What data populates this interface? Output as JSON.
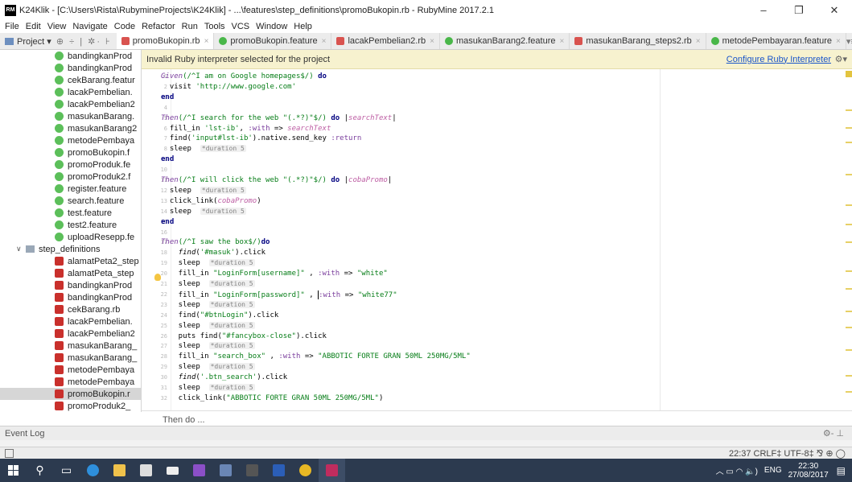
{
  "window": {
    "title": "K24Klik - [C:\\Users\\Rista\\RubymineProjects\\K24Klik] - ...\\features\\step_definitions\\promoBukopin.rb - RubyMine 2017.2.1",
    "app_badge": "RM",
    "minimize": "–",
    "maximize": "❐",
    "close": "✕"
  },
  "menu": [
    "File",
    "Edit",
    "View",
    "Navigate",
    "Code",
    "Refactor",
    "Run",
    "Tools",
    "VCS",
    "Window",
    "Help"
  ],
  "toolwindow": {
    "label": "Project ▾",
    "tools": "⊕ ÷ | ✲· ⊦"
  },
  "tabs": [
    {
      "label": "promoBukopin.rb",
      "type": "rb",
      "active": true
    },
    {
      "label": "promoBukopin.feature",
      "type": "feat"
    },
    {
      "label": "lacakPembelian2.rb",
      "type": "rb"
    },
    {
      "label": "masukanBarang2.feature",
      "type": "feat"
    },
    {
      "label": "masukanBarang_steps2.rb",
      "type": "rb"
    },
    {
      "label": "metodePembayaran.feature",
      "type": "feat"
    }
  ],
  "tab_overflow": "▾≡",
  "tree": [
    {
      "label": "bandingkanProd",
      "type": "feat",
      "indent": 1
    },
    {
      "label": "bandingkanProd",
      "type": "feat",
      "indent": 1
    },
    {
      "label": "cekBarang.featur",
      "type": "feat",
      "indent": 1
    },
    {
      "label": "lacakPembelian.",
      "type": "feat",
      "indent": 1
    },
    {
      "label": "lacakPembelian2",
      "type": "feat",
      "indent": 1
    },
    {
      "label": "masukanBarang.",
      "type": "feat",
      "indent": 1
    },
    {
      "label": "masukanBarang2",
      "type": "feat",
      "indent": 1
    },
    {
      "label": "metodePembaya",
      "type": "feat",
      "indent": 1
    },
    {
      "label": "promoBukopin.f",
      "type": "feat",
      "indent": 1
    },
    {
      "label": "promoProduk.fe",
      "type": "feat",
      "indent": 1
    },
    {
      "label": "promoProduk2.f",
      "type": "feat",
      "indent": 1
    },
    {
      "label": "register.feature",
      "type": "feat",
      "indent": 1
    },
    {
      "label": "search.feature",
      "type": "feat",
      "indent": 1
    },
    {
      "label": "test.feature",
      "type": "feat",
      "indent": 1
    },
    {
      "label": "test2.feature",
      "type": "feat",
      "indent": 1
    },
    {
      "label": "uploadResepp.fe",
      "type": "feat",
      "indent": 1
    },
    {
      "label": "step_definitions",
      "type": "folder",
      "indent": 0
    },
    {
      "label": "alamatPeta2_step",
      "type": "rb",
      "indent": 1
    },
    {
      "label": "alamatPeta_step",
      "type": "rb",
      "indent": 1
    },
    {
      "label": "bandingkanProd",
      "type": "rb",
      "indent": 1
    },
    {
      "label": "bandingkanProd",
      "type": "rb",
      "indent": 1
    },
    {
      "label": "cekBarang.rb",
      "type": "rb",
      "indent": 1
    },
    {
      "label": "lacakPembelian.",
      "type": "rb",
      "indent": 1
    },
    {
      "label": "lacakPembelian2",
      "type": "rb",
      "indent": 1
    },
    {
      "label": "masukanBarang_",
      "type": "rb",
      "indent": 1
    },
    {
      "label": "masukanBarang_",
      "type": "rb",
      "indent": 1
    },
    {
      "label": "metodePembaya",
      "type": "rb",
      "indent": 1
    },
    {
      "label": "metodePembaya",
      "type": "rb",
      "indent": 1
    },
    {
      "label": "promoBukopin.r",
      "type": "rb",
      "indent": 1,
      "selected": true
    },
    {
      "label": "promoProduk2_",
      "type": "rb",
      "indent": 1
    }
  ],
  "notice": {
    "message": "Invalid Ruby interpreter selected for the project",
    "link": "Configure Ruby Interpreter",
    "gear": "⚙▾"
  },
  "code": [
    {
      "n": "1",
      "html": "<span class='k-italic'>Given</span><span class='k-green'>(/^I am on Google homepages$/)</span> <span class='k-kw'>do</span>"
    },
    {
      "n": "2",
      "html": "  visit <span class='k-green'>'http://www.google.com'</span>"
    },
    {
      "n": "3",
      "html": "<span class='k-kw'>end</span>"
    },
    {
      "n": "4",
      "html": ""
    },
    {
      "n": "5",
      "html": "<span class='k-italic'>Then</span><span class='k-green'>(/^I search for the web \"(.*?)\"$/)</span> <span class='k-kw'>do</span> |<span class='k-param'>searchText</span>|"
    },
    {
      "n": "6",
      "html": "  fill_in <span class='k-green'>'lst-ib'</span>, <span class='k-sym'>:with</span> => <span class='k-param'>searchText</span>"
    },
    {
      "n": "7",
      "html": "  find(<span class='k-green'>'input#lst-ib'</span>).native.send_key <span class='k-sym'>:return</span>"
    },
    {
      "n": "8",
      "html": "  sleep  <span class='k-hint'>*duration 5</span>"
    },
    {
      "n": "9",
      "html": "<span class='k-kw'>end</span>"
    },
    {
      "n": "10",
      "html": ""
    },
    {
      "n": "11",
      "html": "<span class='k-italic'>Then</span><span class='k-green'>(/^I will click the web \"(.*?)\"$/)</span> <span class='k-kw'>do</span> |<span class='k-param'>cobaPromo</span>|"
    },
    {
      "n": "12",
      "html": "  sleep  <span class='k-hint'>*duration 5</span>"
    },
    {
      "n": "13",
      "html": "  click_link(<span class='k-param'>cobaPromo</span>)"
    },
    {
      "n": "14",
      "html": "  sleep  <span class='k-hint'>*duration 5</span>"
    },
    {
      "n": "15",
      "html": "<span class='k-kw'>end</span>"
    },
    {
      "n": "16",
      "html": ""
    },
    {
      "n": "17",
      "html": "<span class='k-italic'>Then</span><span class='k-green'>(/^I saw the box$/)</span><span class='k-kw'>do</span>"
    },
    {
      "n": "18",
      "html": "    <i>find</i>(<span class='k-green'>'#masuk'</span>).click"
    },
    {
      "n": "19",
      "html": "    sleep  <span class='k-hint'>*duration 5</span>"
    },
    {
      "n": "20",
      "html": "    fill_in <span class='k-green'>\"LoginForm[username]\"</span> , <span class='k-sym'>:with</span> => <span class='k-green'>\"white\"</span>"
    },
    {
      "n": "21",
      "html": "    sleep  <span class='k-hint'>*duration 5</span>"
    },
    {
      "n": "22",
      "html": "    fill_in <span class='k-green'>\"LoginForm[password]\"</span> , <span class='caret'></span><span class='k-sym'>:with</span> => <span class='k-green'>\"white77\"</span>"
    },
    {
      "n": "23",
      "html": "    sleep  <span class='k-hint'>*duration 5</span>"
    },
    {
      "n": "24",
      "html": "    find(<span class='k-green'>\"#btnLogin\"</span>).click"
    },
    {
      "n": "25",
      "html": "    sleep  <span class='k-hint'>*duration 5</span>"
    },
    {
      "n": "26",
      "html": "    puts find(<span class='k-green'>\"#fancybox-close\"</span>).click"
    },
    {
      "n": "27",
      "html": "    sleep  <span class='k-hint'>*duration 5</span>"
    },
    {
      "n": "28",
      "html": "    fill_in <span class='k-green'>\"search_box\"</span> , <span class='k-sym'>:with</span> => <span class='k-green'>\"ABBOTIC FORTE GRAN 50ML 250MG/5ML\"</span>"
    },
    {
      "n": "29",
      "html": "    sleep  <span class='k-hint'>*duration 5</span>"
    },
    {
      "n": "30",
      "html": "    <i>find</i>(<span class='k-green'>'.btn_search'</span>).click"
    },
    {
      "n": "31",
      "html": "    sleep  <span class='k-hint'>*duration 5</span>"
    },
    {
      "n": "32",
      "html": "    click_link(<span class='k-green'>\"ABBOTIC FORTE GRAN 50ML 250MG/5ML\"</span>)"
    }
  ],
  "breadcrumb": "Then do ...",
  "event_log": "Event Log",
  "status": "22:37  CRLF‡  UTF-8‡  ⅋  ⊕  ◯",
  "tray": {
    "lang": "ENG",
    "time": "22:30",
    "date": "27/08/2017",
    "icons": "︿  ▭  ◠  🔈)  "
  },
  "colors": {
    "taskbar": "#2c3a4f",
    "notice": "#f7f2cf",
    "string": "#067d17"
  }
}
